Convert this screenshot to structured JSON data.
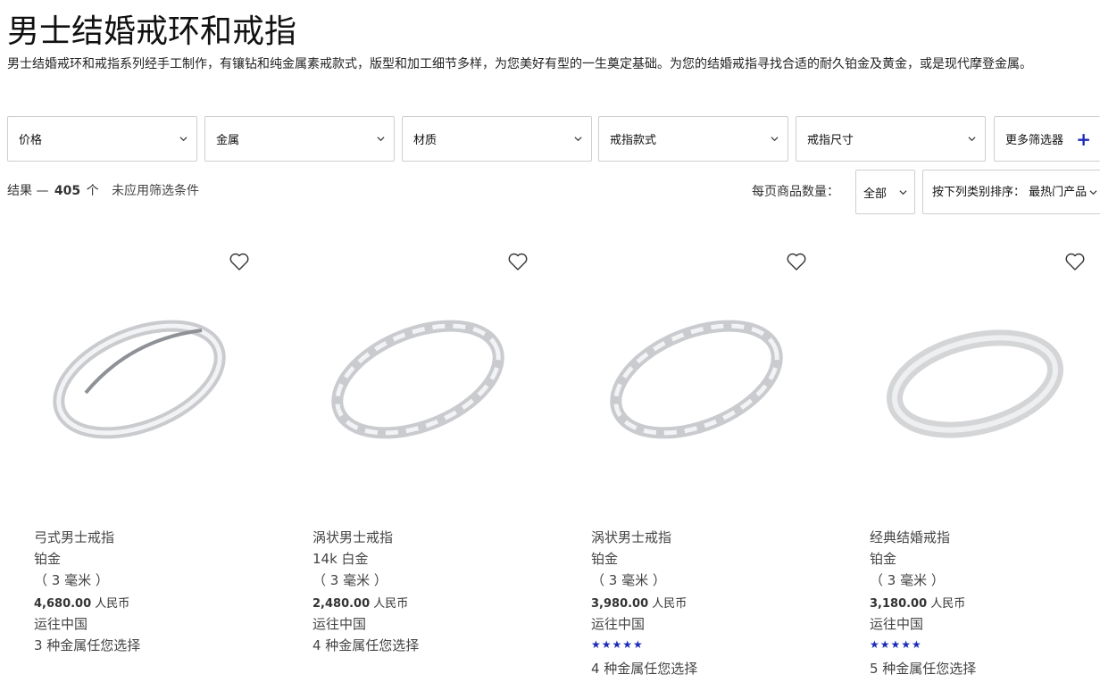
{
  "header": {
    "title": "男士结婚戒环和戒指",
    "description": "男士结婚戒环和戒指系列经手工制作，有镶钻和纯金属素戒款式，版型和加工细节多样，为您美好有型的一生奠定基础。为您的结婚戒指寻找合适的耐久铂金及黄金，或是现代摩登金属。"
  },
  "filters": [
    {
      "label": "价格"
    },
    {
      "label": "金属"
    },
    {
      "label": "材质"
    },
    {
      "label": "戒指款式"
    },
    {
      "label": "戒指尺寸"
    },
    {
      "label": "更多筛选器"
    }
  ],
  "results": {
    "prefix": "结果 —",
    "count": "405",
    "unit": "个",
    "filter_status": "未应用筛选条件"
  },
  "per_page": {
    "label": "每页商品数量：",
    "value": "全部"
  },
  "sort": {
    "value": "按下列类别排序： 最热门产品"
  },
  "products": [
    {
      "name": "弓式男士戒指",
      "metal": "铂金",
      "width": "（ 3 毫米 ）",
      "price": "4,680.00",
      "currency": "人民币",
      "shipping": "运往中国",
      "stars": "",
      "metal_options": "3 种金属任您选择"
    },
    {
      "name": "涡状男士戒指",
      "metal": "14k 白金",
      "width": "（ 3 毫米 ）",
      "price": "2,480.00",
      "currency": "人民币",
      "shipping": "运往中国",
      "stars": "",
      "metal_options": "4 种金属任您选择"
    },
    {
      "name": "涡状男士戒指",
      "metal": "铂金",
      "width": "（ 3 毫米 ）",
      "price": "3,980.00",
      "currency": "人民币",
      "shipping": "运往中国",
      "stars": "★★★★★",
      "metal_options": "4 种金属任您选择"
    },
    {
      "name": "经典结婚戒指",
      "metal": "铂金",
      "width": "（ 3 毫米 ）",
      "price": "3,180.00",
      "currency": "人民币",
      "shipping": "运往中国",
      "stars": "★★★★★",
      "metal_options": "5 种金属任您选择"
    }
  ],
  "colors": {
    "accent": "#1b2bb8",
    "border": "#cfcfcf"
  }
}
